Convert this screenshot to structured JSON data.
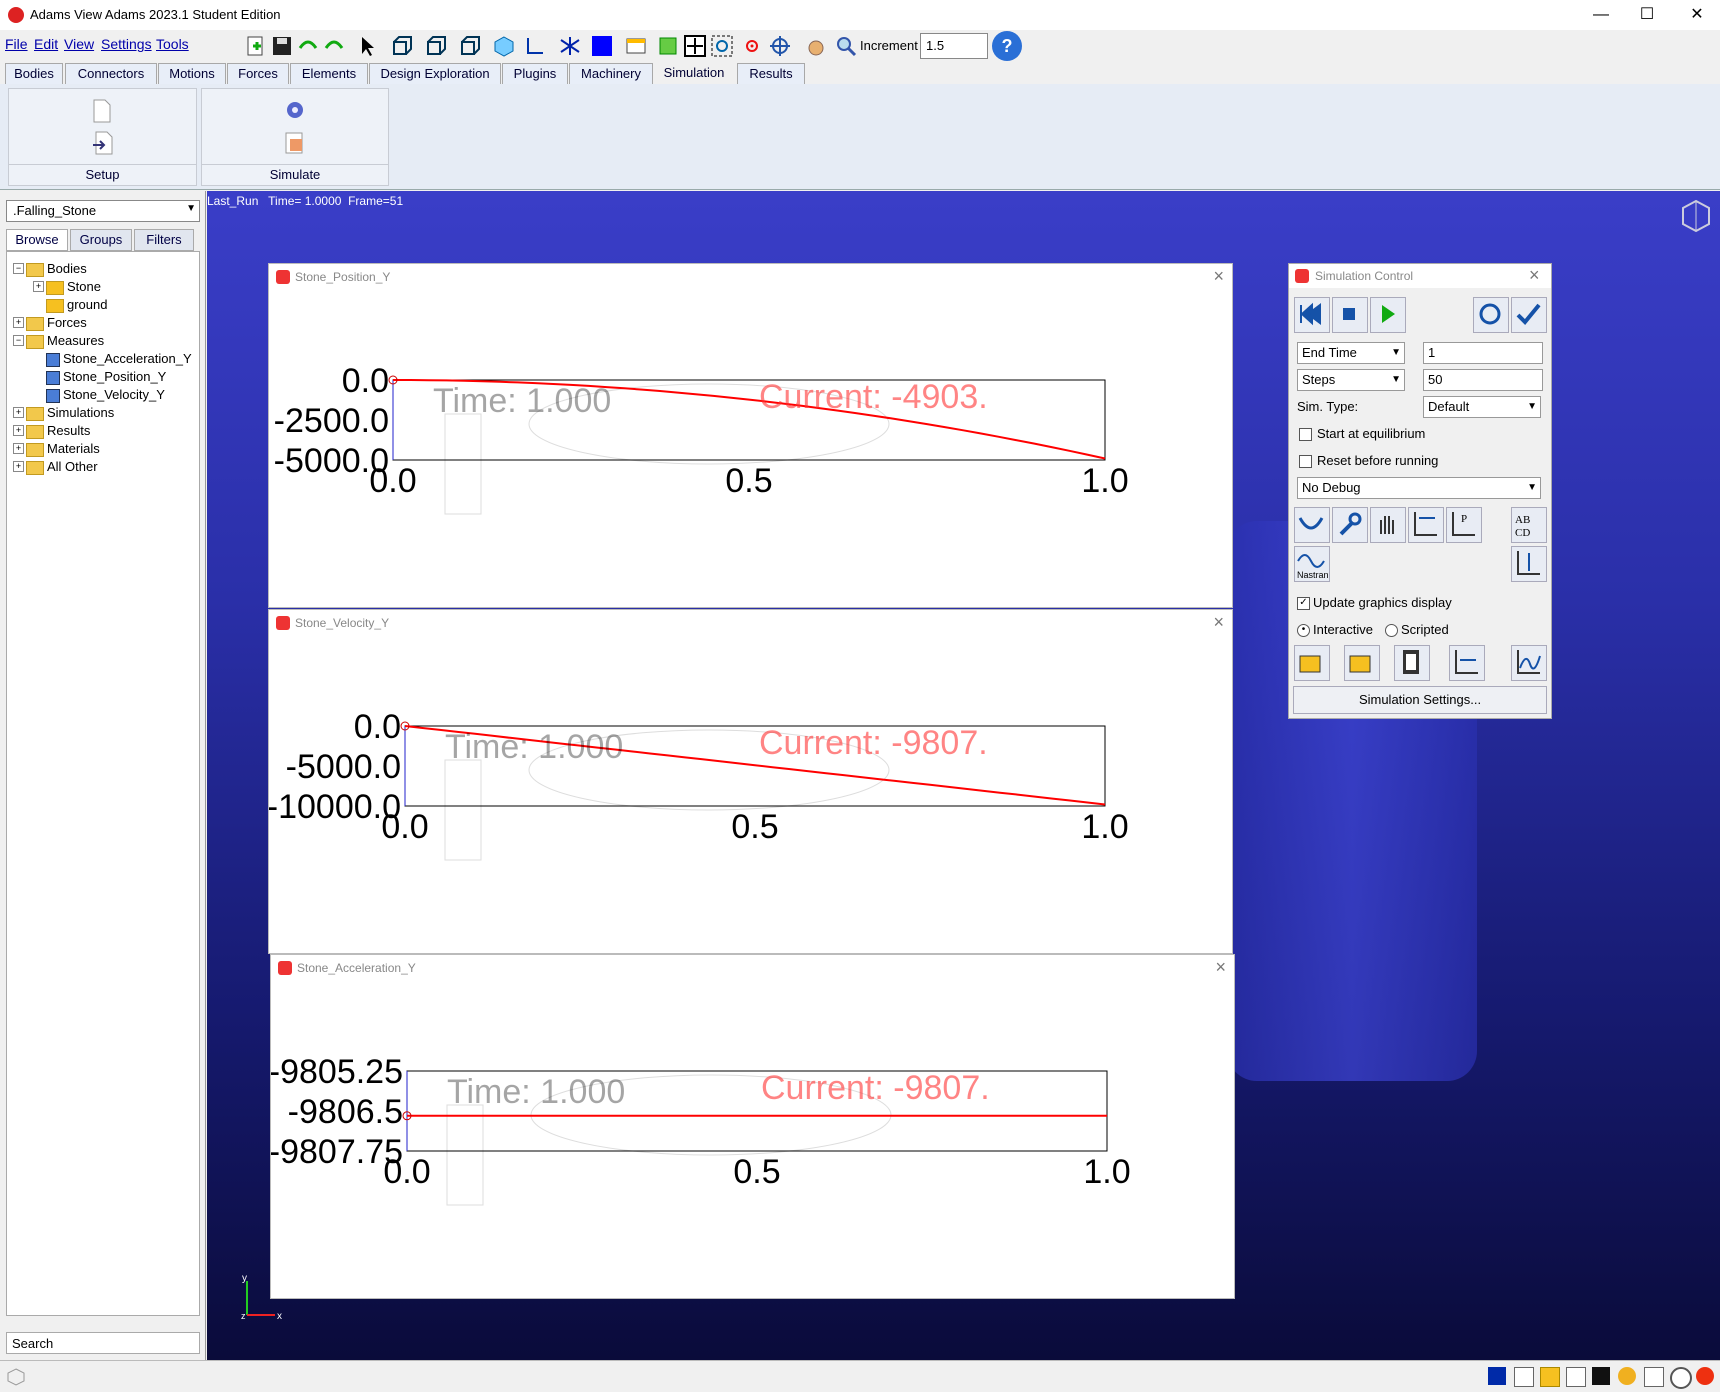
{
  "window": {
    "title": "Adams  View Adams 2023.1 Student Edition",
    "minimize": "—",
    "maximize": "☐",
    "close": "✕"
  },
  "menu": [
    "File",
    "Edit",
    "View",
    "Settings",
    "Tools"
  ],
  "toolbar": {
    "increment_label": "Increment",
    "increment_value": "1.5",
    "help": "?"
  },
  "tabs": [
    "Bodies",
    "Connectors",
    "Motions",
    "Forces",
    "Elements",
    "Design Exploration",
    "Plugins",
    "Machinery",
    "Simulation",
    "Results"
  ],
  "active_tab": "Simulation",
  "ribbon": {
    "setup_label": "Setup",
    "simulate_label": "Simulate"
  },
  "left_panel": {
    "model_select": ".Falling_Stone",
    "tabs": [
      "Browse",
      "Groups",
      "Filters"
    ],
    "tree": {
      "bodies": "Bodies",
      "stone": "Stone",
      "ground": "ground",
      "forces": "Forces",
      "measures": "Measures",
      "m1": "Stone_Acceleration_Y",
      "m2": "Stone_Position_Y",
      "m3": "Stone_Velocity_Y",
      "simulations": "Simulations",
      "results": "Results",
      "materials": "Materials",
      "all_other": "All Other"
    },
    "search": "Search"
  },
  "viewport": {
    "run_label": "Last_Run   Time= 1.0000  Frame=51"
  },
  "plots": [
    {
      "title": "Stone_Position_Y",
      "time_text": "Time:  1.000",
      "current_text": "Current:  -4903.",
      "chart_data": {
        "type": "line",
        "x": [
          0.0,
          0.5,
          1.0
        ],
        "y": [
          0.0,
          -1225.8,
          -4903.3
        ],
        "ylim": [
          -5000.0,
          0.0
        ],
        "yticks": [
          "0.0",
          "-2500.0",
          "-5000.0"
        ],
        "xticks": [
          "0.0",
          "0.5",
          "1.0"
        ]
      }
    },
    {
      "title": "Stone_Velocity_Y",
      "time_text": "Time:  1.000",
      "current_text": "Current:  -9807.",
      "chart_data": {
        "type": "line",
        "x": [
          0.0,
          0.5,
          1.0
        ],
        "y": [
          0.0,
          -4903.3,
          -9806.65
        ],
        "ylim": [
          -10000.0,
          0.0
        ],
        "yticks": [
          "0.0",
          "-5000.0",
          "-10000.0"
        ],
        "xticks": [
          "0.0",
          "0.5",
          "1.0"
        ]
      }
    },
    {
      "title": "Stone_Acceleration_Y",
      "time_text": "Time:  1.000",
      "current_text": "Current:  -9807.",
      "chart_data": {
        "type": "line",
        "x": [
          0.0,
          0.5,
          1.0
        ],
        "y": [
          -9806.65,
          -9806.65,
          -9806.65
        ],
        "ylim": [
          -9807.75,
          -9805.25
        ],
        "yticks": [
          "-9805.25",
          "-9806.5",
          "-9807.75"
        ],
        "xticks": [
          "0.0",
          "0.5",
          "1.0"
        ]
      }
    }
  ],
  "sim_control": {
    "title": "Simulation Control",
    "end_time_label": "End Time",
    "end_time_value": "1",
    "steps_label": "Steps",
    "steps_value": "50",
    "sim_type_label": "Sim. Type:",
    "sim_type_value": "Default",
    "start_eq": "Start at equilibrium",
    "reset": "Reset before running",
    "debug_value": "No Debug",
    "update_graphics": "Update graphics display",
    "interactive": "Interactive",
    "scripted": "Scripted",
    "settings_button": "Simulation Settings...",
    "nastran": "Nastran"
  },
  "colors": {
    "viewport_top": "#3a3ec8",
    "curve": "#ff0000",
    "menu_text": "#0000aa"
  }
}
